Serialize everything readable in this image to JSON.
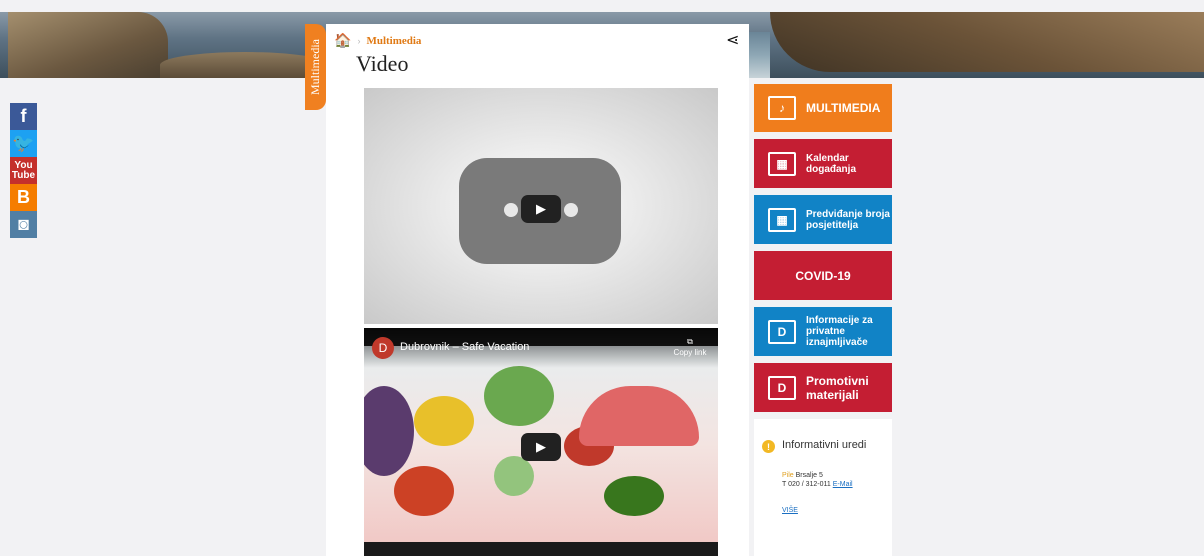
{
  "sidebar_tag": "Multimedia",
  "breadcrumb": {
    "current": "Multimedia"
  },
  "page": {
    "title": "Video"
  },
  "videos": [
    {
      "title": "",
      "state": "loading"
    },
    {
      "channel_initial": "D",
      "title": "Dubrovnik – Safe Vacation",
      "copy_label": "Copy link"
    }
  ],
  "social": {
    "youtube_text": "You Tube"
  },
  "side_tiles": [
    {
      "label": "MULTIMEDIA",
      "color": "#f07d1c"
    },
    {
      "label": "Kalendar događanja",
      "color": "#c41e33"
    },
    {
      "label": "Predviđanje broja posjetitelja",
      "color": "#1183c6"
    },
    {
      "label": "COVID-19",
      "color": "#c41e33"
    },
    {
      "label": "Informacije za privatne iznajmljivače",
      "color": "#1183c6"
    },
    {
      "label": "Promotivni materijali",
      "color": "#c41e33"
    }
  ],
  "info_box": {
    "title": "Informativni uredi",
    "location": "Pile",
    "street": "Brsalje 5",
    "phone": "T 020 / 312-011",
    "email_label": "E-Mail",
    "more_label": "VIŠE"
  }
}
